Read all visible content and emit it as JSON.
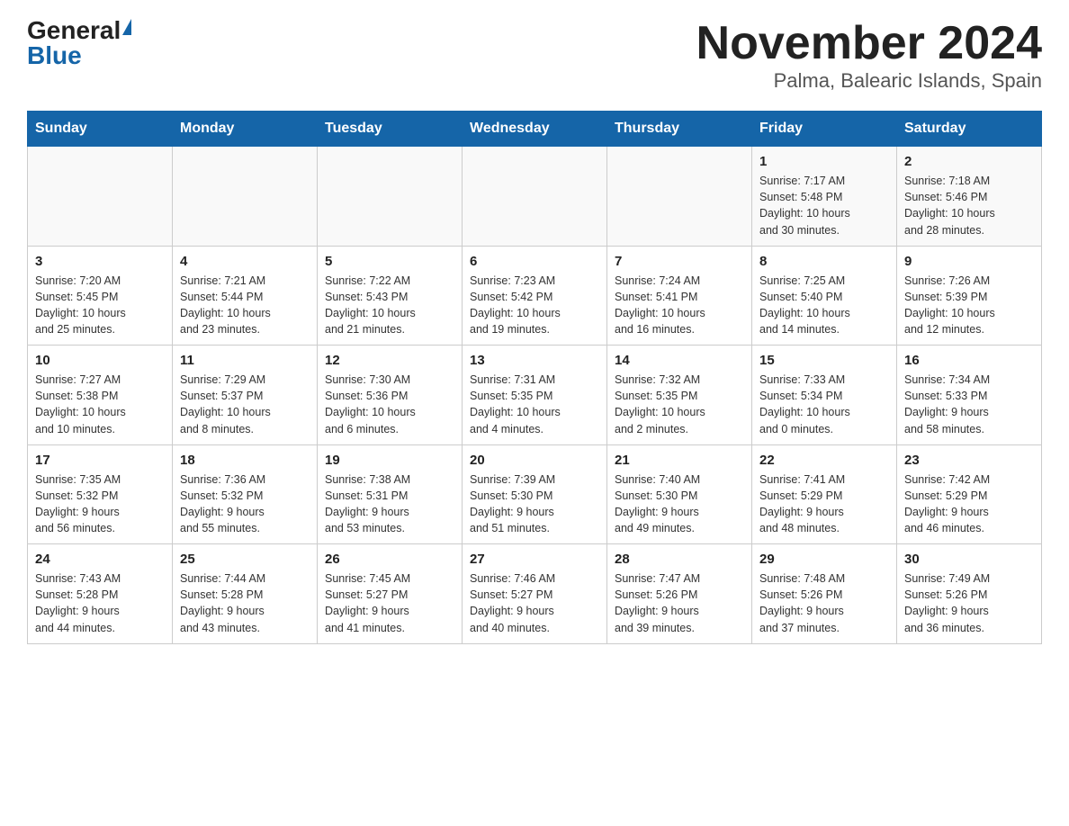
{
  "header": {
    "logo_general": "General",
    "logo_blue": "Blue",
    "title": "November 2024",
    "subtitle": "Palma, Balearic Islands, Spain"
  },
  "days_of_week": [
    "Sunday",
    "Monday",
    "Tuesday",
    "Wednesday",
    "Thursday",
    "Friday",
    "Saturday"
  ],
  "weeks": [
    [
      {
        "day": "",
        "info": ""
      },
      {
        "day": "",
        "info": ""
      },
      {
        "day": "",
        "info": ""
      },
      {
        "day": "",
        "info": ""
      },
      {
        "day": "",
        "info": ""
      },
      {
        "day": "1",
        "info": "Sunrise: 7:17 AM\nSunset: 5:48 PM\nDaylight: 10 hours\nand 30 minutes."
      },
      {
        "day": "2",
        "info": "Sunrise: 7:18 AM\nSunset: 5:46 PM\nDaylight: 10 hours\nand 28 minutes."
      }
    ],
    [
      {
        "day": "3",
        "info": "Sunrise: 7:20 AM\nSunset: 5:45 PM\nDaylight: 10 hours\nand 25 minutes."
      },
      {
        "day": "4",
        "info": "Sunrise: 7:21 AM\nSunset: 5:44 PM\nDaylight: 10 hours\nand 23 minutes."
      },
      {
        "day": "5",
        "info": "Sunrise: 7:22 AM\nSunset: 5:43 PM\nDaylight: 10 hours\nand 21 minutes."
      },
      {
        "day": "6",
        "info": "Sunrise: 7:23 AM\nSunset: 5:42 PM\nDaylight: 10 hours\nand 19 minutes."
      },
      {
        "day": "7",
        "info": "Sunrise: 7:24 AM\nSunset: 5:41 PM\nDaylight: 10 hours\nand 16 minutes."
      },
      {
        "day": "8",
        "info": "Sunrise: 7:25 AM\nSunset: 5:40 PM\nDaylight: 10 hours\nand 14 minutes."
      },
      {
        "day": "9",
        "info": "Sunrise: 7:26 AM\nSunset: 5:39 PM\nDaylight: 10 hours\nand 12 minutes."
      }
    ],
    [
      {
        "day": "10",
        "info": "Sunrise: 7:27 AM\nSunset: 5:38 PM\nDaylight: 10 hours\nand 10 minutes."
      },
      {
        "day": "11",
        "info": "Sunrise: 7:29 AM\nSunset: 5:37 PM\nDaylight: 10 hours\nand 8 minutes."
      },
      {
        "day": "12",
        "info": "Sunrise: 7:30 AM\nSunset: 5:36 PM\nDaylight: 10 hours\nand 6 minutes."
      },
      {
        "day": "13",
        "info": "Sunrise: 7:31 AM\nSunset: 5:35 PM\nDaylight: 10 hours\nand 4 minutes."
      },
      {
        "day": "14",
        "info": "Sunrise: 7:32 AM\nSunset: 5:35 PM\nDaylight: 10 hours\nand 2 minutes."
      },
      {
        "day": "15",
        "info": "Sunrise: 7:33 AM\nSunset: 5:34 PM\nDaylight: 10 hours\nand 0 minutes."
      },
      {
        "day": "16",
        "info": "Sunrise: 7:34 AM\nSunset: 5:33 PM\nDaylight: 9 hours\nand 58 minutes."
      }
    ],
    [
      {
        "day": "17",
        "info": "Sunrise: 7:35 AM\nSunset: 5:32 PM\nDaylight: 9 hours\nand 56 minutes."
      },
      {
        "day": "18",
        "info": "Sunrise: 7:36 AM\nSunset: 5:32 PM\nDaylight: 9 hours\nand 55 minutes."
      },
      {
        "day": "19",
        "info": "Sunrise: 7:38 AM\nSunset: 5:31 PM\nDaylight: 9 hours\nand 53 minutes."
      },
      {
        "day": "20",
        "info": "Sunrise: 7:39 AM\nSunset: 5:30 PM\nDaylight: 9 hours\nand 51 minutes."
      },
      {
        "day": "21",
        "info": "Sunrise: 7:40 AM\nSunset: 5:30 PM\nDaylight: 9 hours\nand 49 minutes."
      },
      {
        "day": "22",
        "info": "Sunrise: 7:41 AM\nSunset: 5:29 PM\nDaylight: 9 hours\nand 48 minutes."
      },
      {
        "day": "23",
        "info": "Sunrise: 7:42 AM\nSunset: 5:29 PM\nDaylight: 9 hours\nand 46 minutes."
      }
    ],
    [
      {
        "day": "24",
        "info": "Sunrise: 7:43 AM\nSunset: 5:28 PM\nDaylight: 9 hours\nand 44 minutes."
      },
      {
        "day": "25",
        "info": "Sunrise: 7:44 AM\nSunset: 5:28 PM\nDaylight: 9 hours\nand 43 minutes."
      },
      {
        "day": "26",
        "info": "Sunrise: 7:45 AM\nSunset: 5:27 PM\nDaylight: 9 hours\nand 41 minutes."
      },
      {
        "day": "27",
        "info": "Sunrise: 7:46 AM\nSunset: 5:27 PM\nDaylight: 9 hours\nand 40 minutes."
      },
      {
        "day": "28",
        "info": "Sunrise: 7:47 AM\nSunset: 5:26 PM\nDaylight: 9 hours\nand 39 minutes."
      },
      {
        "day": "29",
        "info": "Sunrise: 7:48 AM\nSunset: 5:26 PM\nDaylight: 9 hours\nand 37 minutes."
      },
      {
        "day": "30",
        "info": "Sunrise: 7:49 AM\nSunset: 5:26 PM\nDaylight: 9 hours\nand 36 minutes."
      }
    ]
  ]
}
